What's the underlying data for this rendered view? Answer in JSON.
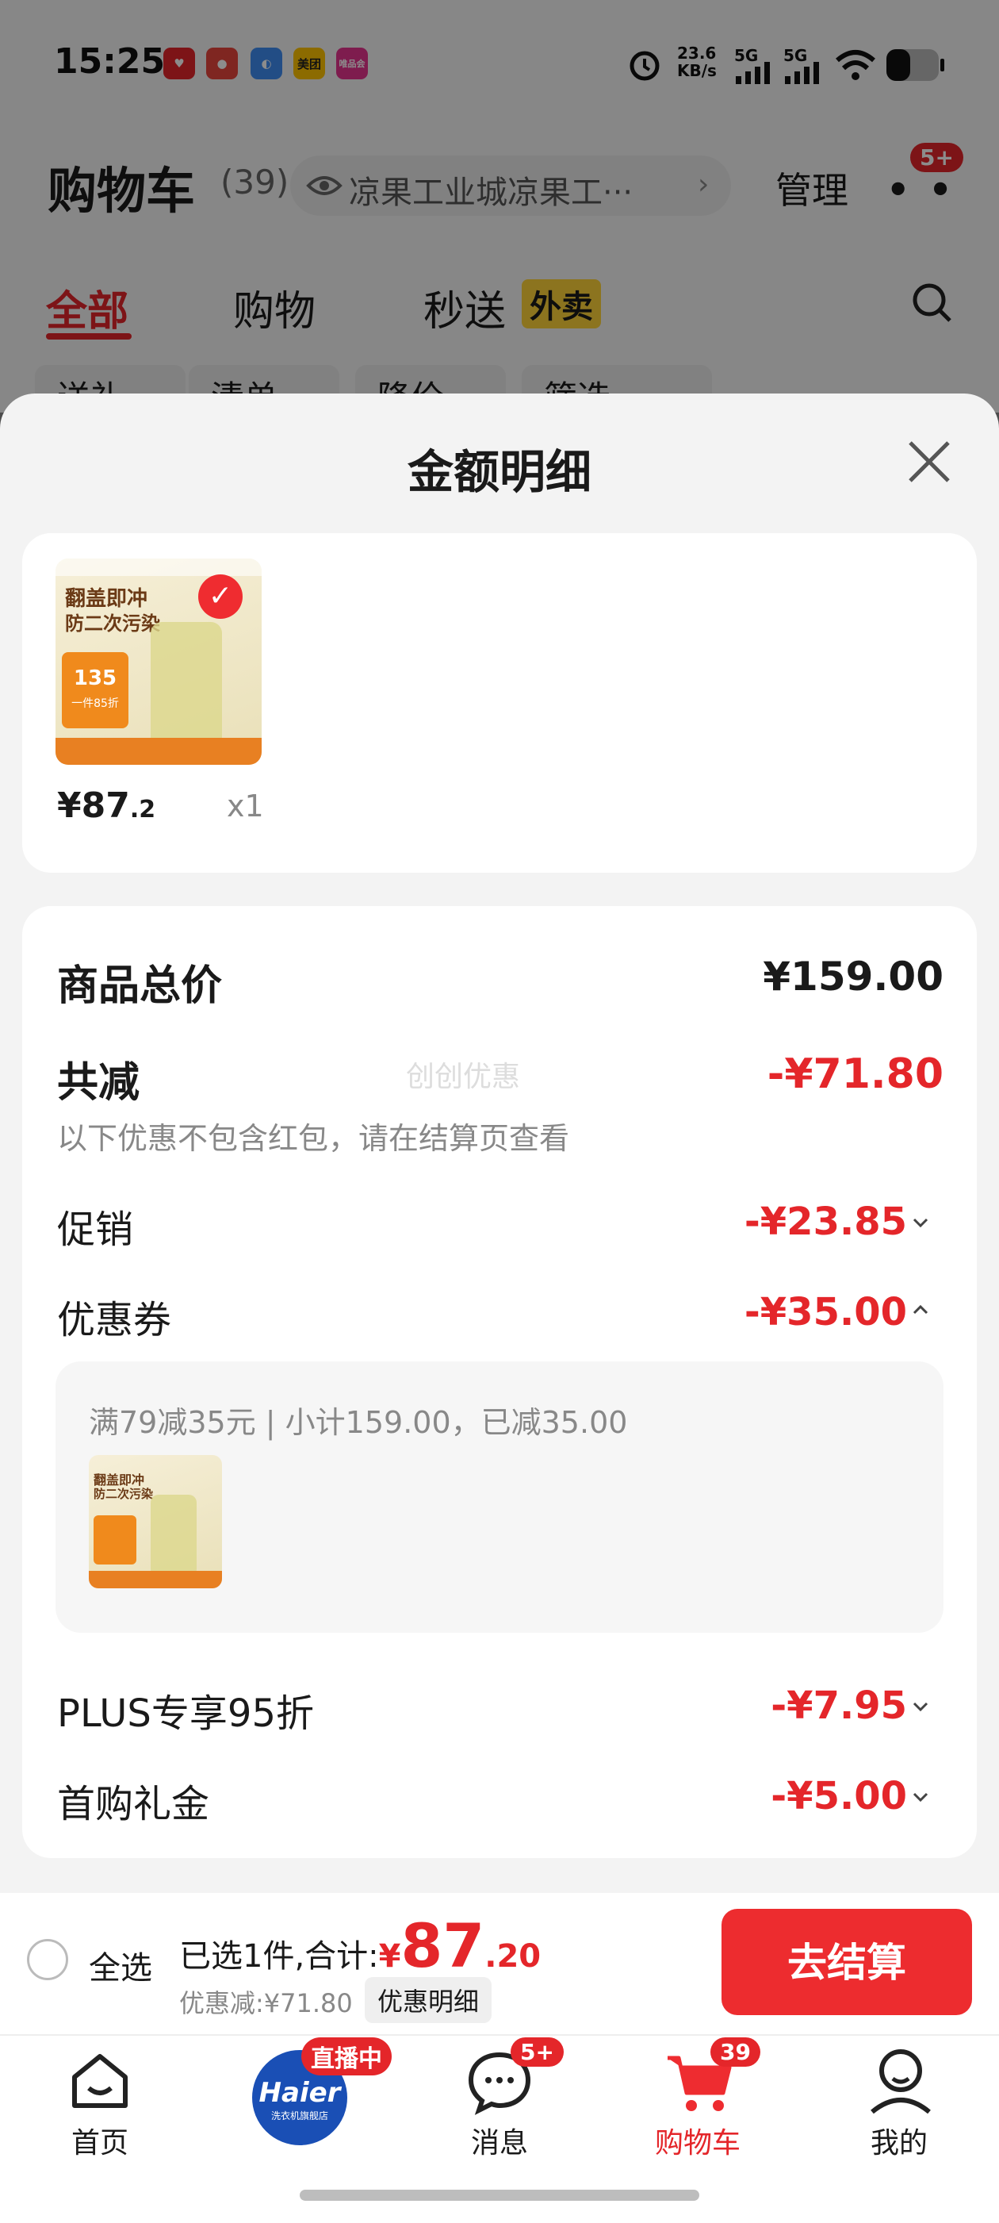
{
  "status_bar": {
    "time": "15:25",
    "app_icons": [
      {
        "label": "",
        "color": "#e4262a",
        "name": "pdd"
      },
      {
        "label": "",
        "color": "#e7463c",
        "name": "jd"
      },
      {
        "label": "",
        "color": "#3f8cf2",
        "name": "qq"
      },
      {
        "label": "美团",
        "color": "#ffc300",
        "name": "meituan"
      },
      {
        "label": "唯品会",
        "color": "#e6338e",
        "name": "vip"
      }
    ],
    "net_speed_top": "23.6",
    "net_speed_bottom": "KB/s",
    "signal1": "5G",
    "signal2": "5G"
  },
  "header": {
    "title": "购物车",
    "count": "(39)",
    "address": "凉果工业城凉果工···",
    "manage": "管理",
    "more_badge": "5+"
  },
  "tabs": [
    {
      "label": "全部",
      "active": true
    },
    {
      "label": "购物",
      "active": false
    },
    {
      "label": "秒送",
      "active": false
    }
  ],
  "tab_badge": "外卖",
  "filter_chips": [
    "送礼",
    "清单",
    "降价",
    "筛选"
  ],
  "sheet": {
    "title": "金额明细",
    "product": {
      "price_int": "¥87",
      "price_dec": ".2",
      "qty": "x1",
      "thumb_text1": "翻盖即冲",
      "thumb_text2": "防二次污染",
      "thumb_price": "135",
      "thumb_tag": "一件85折"
    },
    "summary": {
      "total_label": "商品总价",
      "total_value": "¥159.00",
      "reduce_label": "共减",
      "reduce_value": "-¥71.80",
      "watermark": "创创优惠",
      "note": "以下优惠不包含红包，请在结算页查看",
      "rows": [
        {
          "label": "促销",
          "value": "-¥23.85",
          "expanded": false
        },
        {
          "label": "优惠券",
          "value": "-¥35.00",
          "expanded": true
        }
      ],
      "coupon_detail": "满79减35元 | 小计159.00，已减35.00",
      "rows_after": [
        {
          "label": "PLUS专享95折",
          "value": "-¥7.95",
          "expanded": false
        },
        {
          "label": "首购礼金",
          "value": "-¥5.00",
          "expanded": false
        }
      ]
    }
  },
  "checkout": {
    "select_all": "全选",
    "selected_text": "已选1件,合计:",
    "currency": "¥",
    "total_int": "87",
    "total_dec": ".20",
    "discount_text": "优惠减:¥71.80",
    "detail_button": "优惠明细",
    "submit": "去结算"
  },
  "nav": {
    "items": [
      {
        "label": "首页",
        "active": false
      },
      {
        "label": "",
        "active": false
      },
      {
        "label": "消息",
        "active": false
      },
      {
        "label": "购物车",
        "active": true
      },
      {
        "label": "我的",
        "active": false
      }
    ],
    "live_badge": "直播中",
    "haier_text": "Haier",
    "haier_sub": "洗衣机旗舰店",
    "msg_badge": "5+",
    "cart_badge": "39"
  },
  "colors": {
    "accent": "#e4262a",
    "sheet_bg": "#f3f3f3"
  }
}
